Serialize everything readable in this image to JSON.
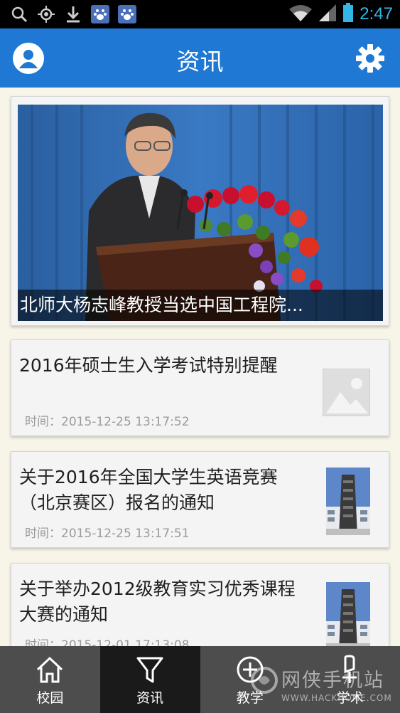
{
  "status_bar": {
    "time": "2:47",
    "left_icons": [
      "search-icon",
      "gps-icon",
      "download-icon",
      "baidu-icon",
      "baidu-icon"
    ],
    "right_icons": [
      "wifi-icon",
      "signal-icon",
      "battery-icon"
    ]
  },
  "header": {
    "title": "资讯",
    "left_icon": "user-avatar-icon",
    "right_icon": "gear-icon",
    "background_color": "#1e78d4"
  },
  "featured": {
    "caption": "北师大杨志峰教授当选中国工程院..."
  },
  "news": [
    {
      "title": "2016年硕士生入学考试特别提醒",
      "time": "时间：2015-12-25 13:17:52",
      "thumbnail": "placeholder"
    },
    {
      "title": "关于2016年全国大学生英语竞赛（北京赛区）报名的通知",
      "time": "时间：2015-12-25 13:17:51",
      "thumbnail": "building-photo"
    },
    {
      "title": "关于举办2012级教育实习优秀课程大赛的通知",
      "time": "时间：2015-12-01 17:13:08",
      "thumbnail": "building-photo"
    }
  ],
  "bottom_nav": [
    {
      "label": "校园",
      "icon": "home-icon",
      "active": false
    },
    {
      "label": "资讯",
      "icon": "filter-icon",
      "active": true
    },
    {
      "label": "教学",
      "icon": "plus-circle-icon",
      "active": false
    },
    {
      "label": "学术",
      "icon": "academic-icon",
      "active": false
    }
  ],
  "watermark": {
    "text": "网侠手机站",
    "url": "WWW.HACKHOME.COM"
  }
}
